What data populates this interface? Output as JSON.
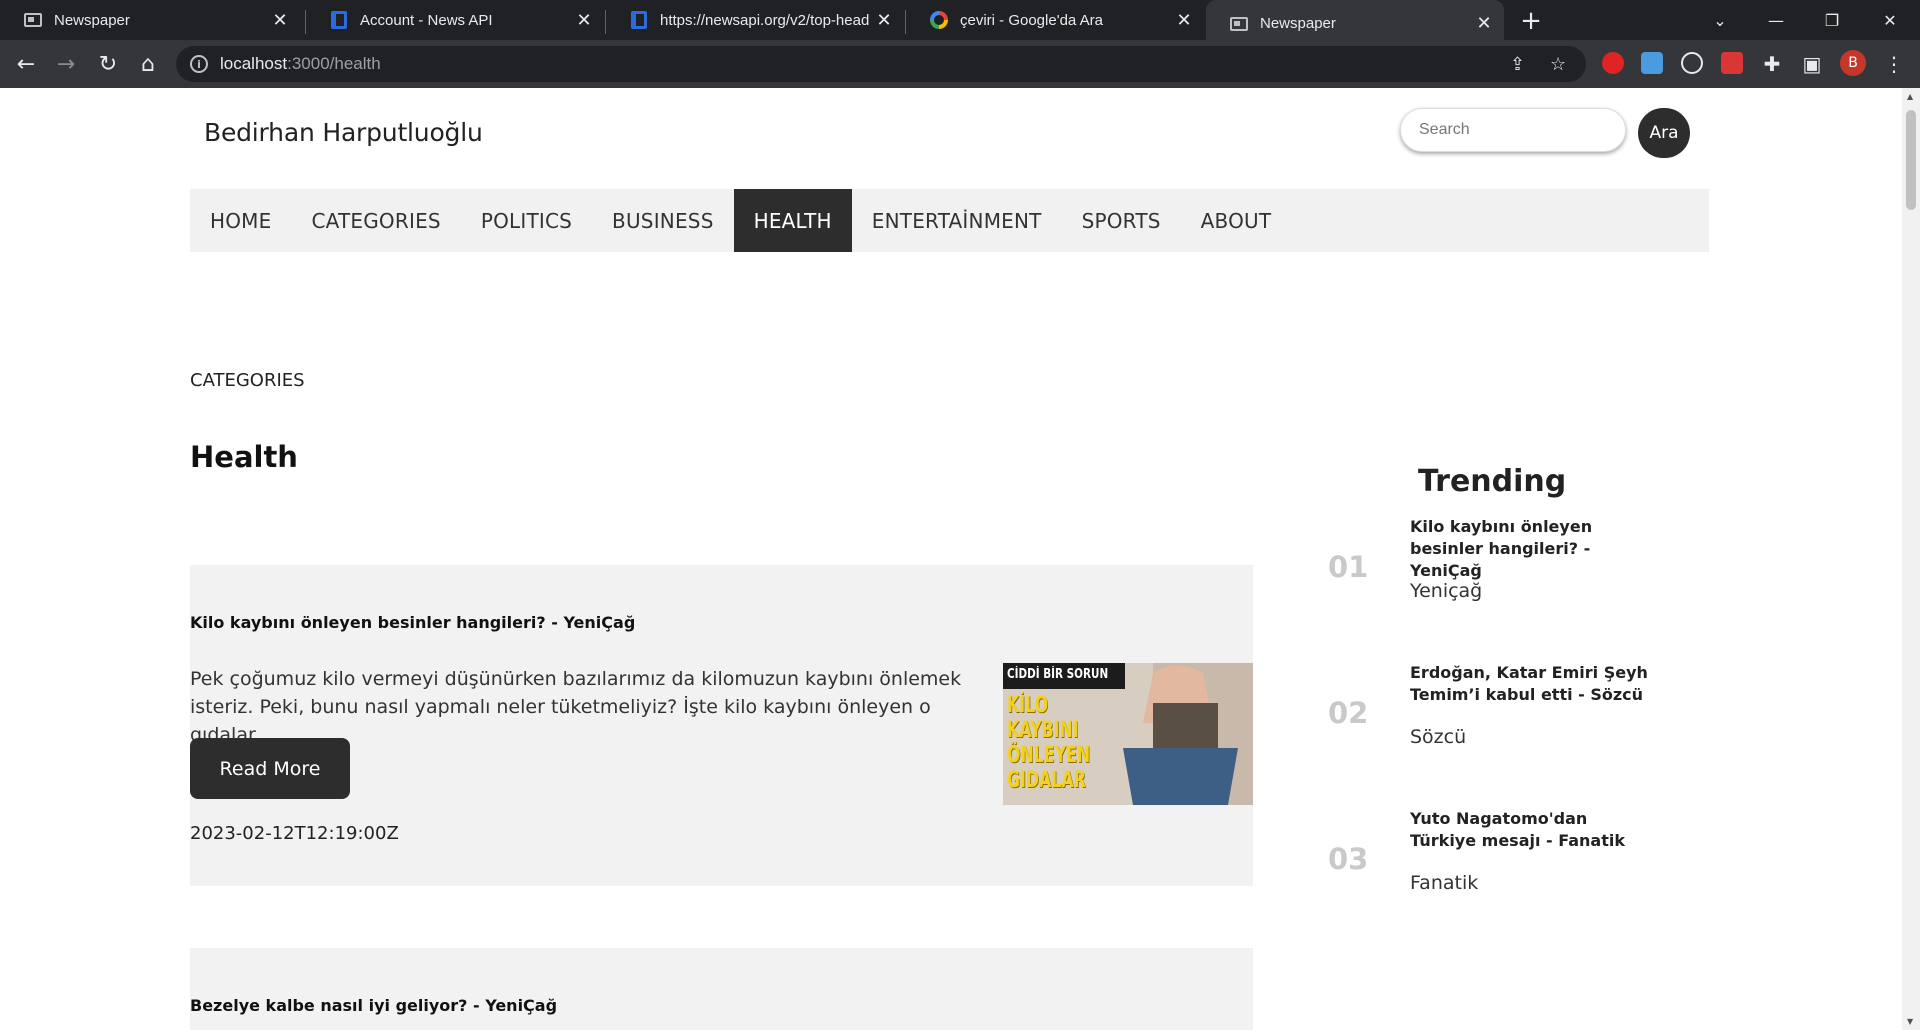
{
  "browser": {
    "tabs": [
      {
        "title": "Newspaper",
        "icon": "newspaper-favicon",
        "active": false
      },
      {
        "title": "Account - News API",
        "icon": "newsapi-favicon",
        "active": false
      },
      {
        "title": "https://newsapi.org/v2/top-head",
        "icon": "newsapi-favicon",
        "active": false
      },
      {
        "title": "çeviri - Google'da Ara",
        "icon": "google-favicon",
        "active": false
      },
      {
        "title": "Newspaper",
        "icon": "newspaper-favicon",
        "active": true
      }
    ],
    "address": {
      "host": "localhost",
      "rest": ":3000/health"
    },
    "profile_initial": "B"
  },
  "site": {
    "brand": "Bedirhan Harputluoğlu",
    "search": {
      "placeholder": "Search",
      "button_label": "Ara"
    },
    "nav": [
      {
        "label": "HOME",
        "active": false
      },
      {
        "label": "CATEGORIES",
        "active": false
      },
      {
        "label": "POLITICS",
        "active": false
      },
      {
        "label": "BUSINESS",
        "active": false
      },
      {
        "label": "HEALTH",
        "active": true
      },
      {
        "label": "ENTERTAİNMENT",
        "active": false
      },
      {
        "label": "SPORTS",
        "active": false
      },
      {
        "label": "ABOUT",
        "active": false
      }
    ]
  },
  "main": {
    "breadcrumb": "CATEGORIES",
    "title": "Health",
    "articles": [
      {
        "title": "Kilo kaybını önleyen besinler hangileri? - YeniÇağ",
        "description": "Pek çoğumuz kilo vermeyi düşünürken bazılarımız da kilomuzun kaybını önlemek isteriz. Peki, bunu nasıl yapmalı neler tüketmeliyiz? İşte kilo kaybını önleyen o gıdalar...",
        "read_more": "Read More",
        "published_at": "2023-02-12T12:19:00Z",
        "image": {
          "banner": "CİDDİ BİR SORUN",
          "headline": [
            "KİLO",
            "KAYBINI",
            "ÖNLEYEN",
            "GIDALAR"
          ]
        }
      },
      {
        "title": "Bezelye kalbe nasıl iyi geliyor? - YeniÇağ"
      }
    ]
  },
  "trending": {
    "heading": "Trending",
    "items": [
      {
        "number": "01",
        "title": "Kilo kaybını önleyen besinler hangileri? - YeniÇağ",
        "source": "Yeniçağ"
      },
      {
        "number": "02",
        "title": "Erdoğan, Katar Emiri Şeyh Temim’i kabul etti - Sözcü",
        "source": "Sözcü"
      },
      {
        "number": "03",
        "title": "Yuto Nagatomo'dan Türkiye mesajı - Fanatik",
        "source": "Fanatik"
      }
    ]
  },
  "colors": {
    "dark": "#2d2d2d",
    "panel": "#f2f2f2",
    "trend_number": "#c9c9c9",
    "profile": "#c5372a"
  }
}
